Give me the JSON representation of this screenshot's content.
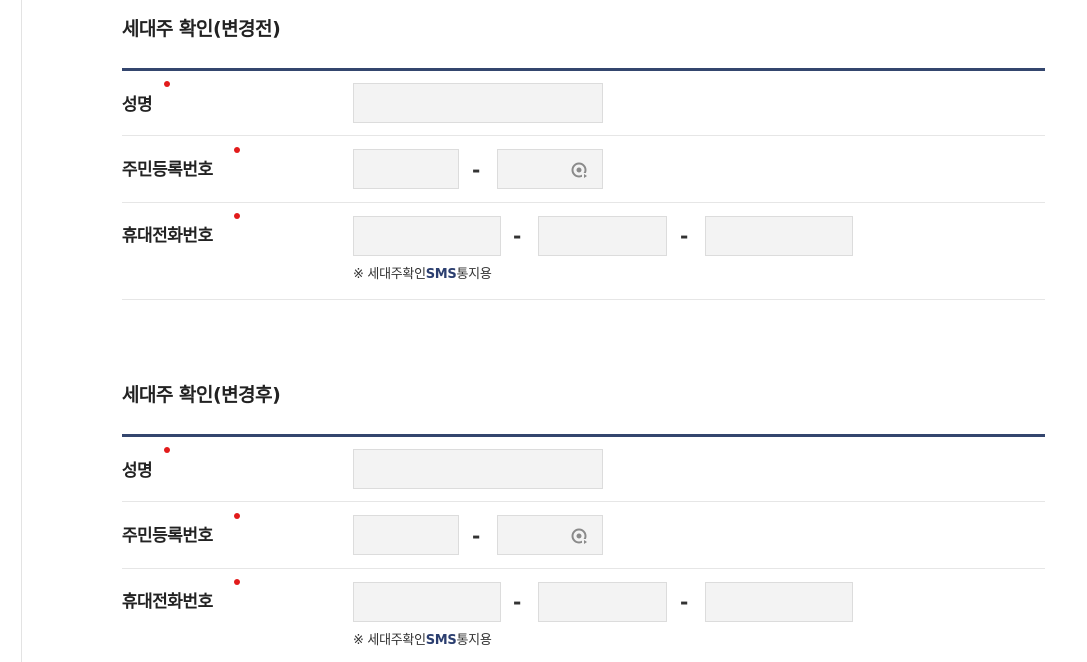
{
  "sections": [
    {
      "title": "세대주 확인(변경전)",
      "name_label": "성명",
      "rrn_label": "주민등록번호",
      "phone_label": "휴대전화번호",
      "rrn_separator": "-",
      "phone_separator": "-",
      "sms_note_prefix": "※ 세대주확인",
      "sms_note_highlight": "SMS",
      "sms_note_suffix": "통지용",
      "fields": {
        "name": "",
        "rrn_front": "",
        "rrn_back": "",
        "phone_1": "",
        "phone_2": "",
        "phone_3": ""
      }
    },
    {
      "title": "세대주 확인(변경후)",
      "name_label": "성명",
      "rrn_label": "주민등록번호",
      "phone_label": "휴대전화번호",
      "rrn_separator": "-",
      "phone_separator": "-",
      "sms_note_prefix": "※ 세대주확인",
      "sms_note_highlight": "SMS",
      "sms_note_suffix": "통지용",
      "fields": {
        "name": "",
        "rrn_front": "",
        "rrn_back": "",
        "phone_1": "",
        "phone_2": "",
        "phone_3": ""
      }
    }
  ],
  "colors": {
    "title_rule": "#34466e",
    "required_dot": "#e21b1b",
    "input_bg": "#f3f3f3",
    "input_border": "#dcdcdc",
    "sms_highlight": "#2b3e6f"
  },
  "icons": {
    "security_keypad": "virtual-keypad-icon"
  }
}
